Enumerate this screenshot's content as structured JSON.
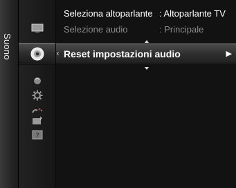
{
  "menu": {
    "category_label": "Suono",
    "icons": [
      {
        "name": "picture-menu-icon",
        "selected": false
      },
      {
        "name": "sound-menu-icon",
        "selected": true
      },
      {
        "name": "channel-menu-icon",
        "selected": false
      },
      {
        "name": "setup-menu-icon",
        "selected": false
      },
      {
        "name": "input-menu-icon",
        "selected": false
      },
      {
        "name": "application-menu-icon",
        "selected": false
      },
      {
        "name": "support-menu-icon",
        "selected": false
      }
    ]
  },
  "items": [
    {
      "label": "Seleziona altoparlante",
      "value": ": Altoparlante TV",
      "state": "active"
    },
    {
      "label": "Selezione audio",
      "value": ": Principale",
      "state": "disabled"
    }
  ],
  "selected_item": {
    "label": "Reset impostazioni audio",
    "left_arrow": "‹",
    "right_arrow": "▶"
  },
  "colors": {
    "background": "#0a0a0a",
    "text_active": "#ffffff",
    "text_disabled": "#8a8a8a",
    "selection": "#3a3a3a"
  }
}
